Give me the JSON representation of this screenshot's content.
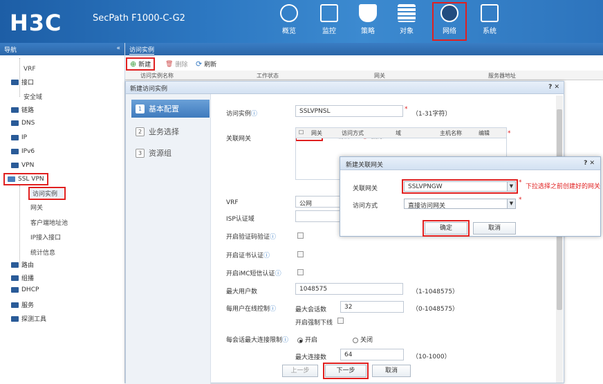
{
  "header": {
    "logo": "H3C",
    "product": "SecPath F1000-C-G2",
    "nav": [
      {
        "label": "概览",
        "icon": "dashboard-icon"
      },
      {
        "label": "监控",
        "icon": "monitor-icon"
      },
      {
        "label": "策略",
        "icon": "shield-icon"
      },
      {
        "label": "对象",
        "icon": "object-icon"
      },
      {
        "label": "网络",
        "icon": "globe-icon"
      },
      {
        "label": "系统",
        "icon": "system-icon"
      }
    ]
  },
  "sidebar": {
    "title": "导航",
    "collapse": "«",
    "items": [
      "VRF",
      "接口",
      "安全域",
      "链路",
      "DNS",
      "IP",
      "IPv6",
      "VPN",
      "SSL VPN",
      "路由",
      "组播",
      "DHCP",
      "服务",
      "探测工具"
    ],
    "sslvpn_children": [
      "访问实例",
      "网关",
      "客户端地址池",
      "IP接入接口",
      "统计信息"
    ]
  },
  "main": {
    "tab": "访问实例",
    "toolbar": {
      "new": "新建",
      "delete": "删除",
      "refresh": "刷新"
    },
    "columns": [
      "访问实例名称",
      "工作状态",
      "网关",
      "服务器地址"
    ]
  },
  "dialog": {
    "title": "新建访问实例",
    "controls": "? ✕",
    "steps": [
      {
        "n": "1",
        "label": "基本配置"
      },
      {
        "n": "2",
        "label": "业务选择"
      },
      {
        "n": "3",
        "label": "资源组"
      }
    ],
    "fields": {
      "instance_label": "访问实例",
      "instance_value": "SSLVPNSL",
      "instance_hint": "（1-31字符）",
      "gateway_label": "关联网关",
      "gw_new": "新建",
      "gw_edit": "编辑",
      "gw_delete": "删除",
      "gw_columns": [
        "网关",
        "访问方式",
        "域",
        "主机名称",
        "编辑"
      ],
      "vrf_label": "VRF",
      "vrf_value": "公网",
      "isp_label": "ISP认证域",
      "verify_label": "开启验证码验证",
      "cert_label": "开启证书认证",
      "imc_label": "开启iMC短信认证",
      "max_users_label": "最大用户数",
      "max_users_value": "1048575",
      "max_users_hint": "（1-1048575）",
      "per_user_label": "每用户在线控制",
      "max_sessions_label": "最大会话数",
      "max_sessions_value": "32",
      "max_sessions_hint": "（0-1048575）",
      "force_offline_label": "开启强制下线",
      "max_conn_label": "每会话最大连接限制",
      "on_label": "开启",
      "off_label": "关闭",
      "max_conn_num_label": "最大连接数",
      "max_conn_num_value": "64",
      "max_conn_num_hint": "（10-1000）"
    },
    "buttons": {
      "prev": "上一步",
      "next": "下一步",
      "cancel": "取消"
    }
  },
  "popup": {
    "title": "新建关联网关",
    "controls": "? ✕",
    "gw_label": "关联网关",
    "gw_value": "SSLVPNGW",
    "access_label": "访问方式",
    "access_value": "直接访问网关",
    "ok": "确定",
    "cancel": "取消",
    "note": "下拉选择之前创建好的网关"
  }
}
